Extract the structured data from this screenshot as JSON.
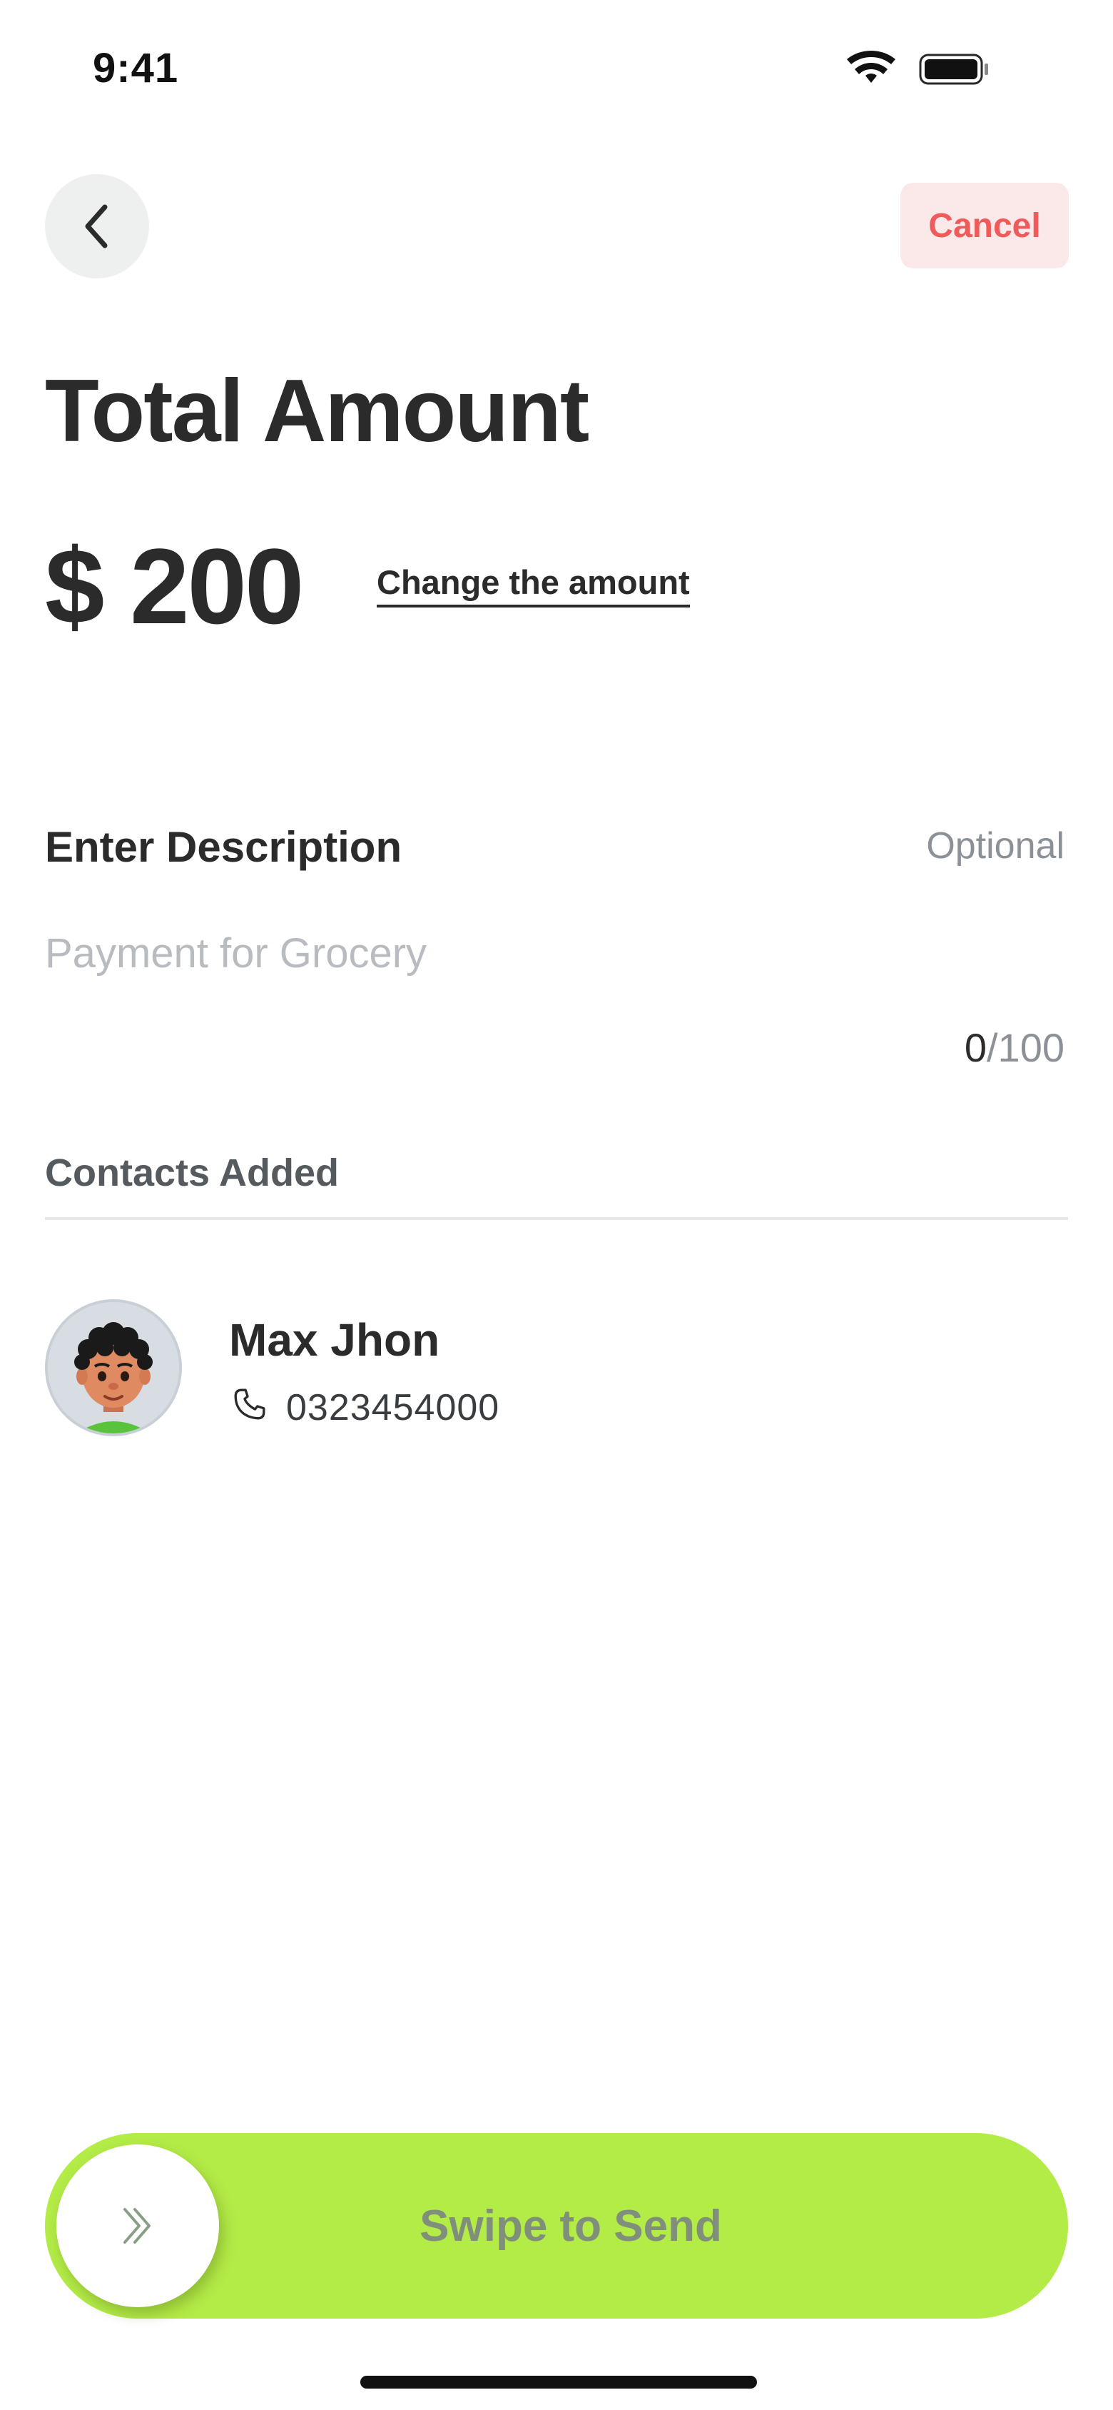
{
  "status_bar": {
    "time": "9:41",
    "icons": [
      "wifi-icon",
      "battery-icon"
    ]
  },
  "nav": {
    "back_icon": "chevron-left-icon",
    "cancel_label": "Cancel"
  },
  "title": "Total Amount",
  "amount": {
    "value": "$ 200",
    "change_link": "Change the amount"
  },
  "description": {
    "label": "Enter Description",
    "optional_label": "Optional",
    "value": "",
    "placeholder": "Payment for Grocery",
    "counter_current": "0",
    "counter_max": "/100"
  },
  "contacts": {
    "label": "Contacts Added",
    "items": [
      {
        "name": "Max Jhon",
        "phone": "0323454000",
        "phone_icon": "phone-icon",
        "avatar": "avatar-image"
      }
    ]
  },
  "swipe": {
    "label": "Swipe to Send",
    "handle_icon": "double-chevron-right-icon"
  },
  "colors": {
    "accent": "#b3eb47",
    "cancel_text": "#ef5a5a",
    "cancel_bg": "#fbe9e9",
    "primary_text": "#2b2b2b",
    "muted_text": "#8c9197"
  }
}
